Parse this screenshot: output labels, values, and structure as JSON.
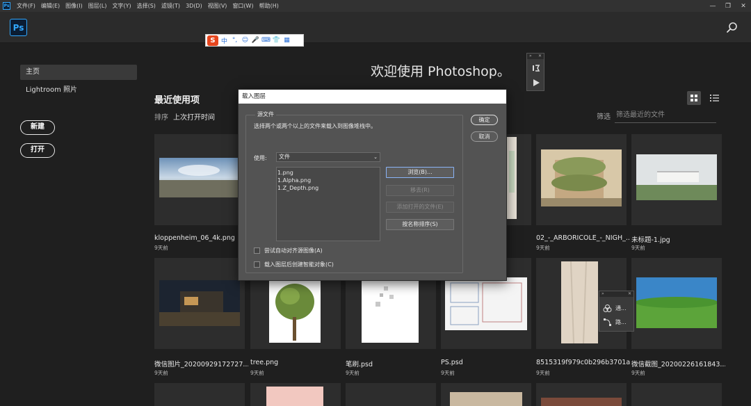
{
  "menubar": {
    "app_icon": "Ps",
    "items": [
      "文件(F)",
      "编辑(E)",
      "图像(I)",
      "图层(L)",
      "文字(Y)",
      "选择(S)",
      "滤镜(T)",
      "3D(D)",
      "视图(V)",
      "窗口(W)",
      "帮助(H)"
    ],
    "window_controls": [
      "—",
      "❐",
      "✕"
    ]
  },
  "header": {
    "logo": "Ps",
    "search_icon": "search-icon"
  },
  "ime": {
    "logo": "S",
    "glyphs": [
      "中",
      "°,",
      "☺",
      "🎤",
      "⌨",
      "👕",
      "▦"
    ]
  },
  "sidebar": {
    "items": [
      "主页",
      "Lightroom 照片"
    ],
    "new_button": "新建",
    "open_button": "打开"
  },
  "home": {
    "welcome": "欢迎使用 Photoshop。",
    "recent_title": "最近使用项",
    "sort_label": "排序",
    "sort_value": "上次打开时间",
    "filter_label": "筛选",
    "filter_placeholder": "筛选最近的文件"
  },
  "files": [
    {
      "name": "kloppenheim_06_4k.png",
      "date": "9天前"
    },
    {
      "name": "",
      "date": ""
    },
    {
      "name": "",
      "date": ""
    },
    {
      "name": "",
      "date": ""
    },
    {
      "name": "02_-_ARBORICOLE_-_NIGH_...",
      "date": "9天前"
    },
    {
      "name": "未标题-1.jpg",
      "date": "9天前"
    },
    {
      "name": "微信图片_20200929172727....",
      "date": "9天前"
    },
    {
      "name": "tree.png",
      "date": "9天前"
    },
    {
      "name": "笔刷.psd",
      "date": "9天前"
    },
    {
      "name": "PS.psd",
      "date": "9天前"
    },
    {
      "name": "8515319f979c0b296b3701a...",
      "date": "9天前"
    },
    {
      "name": "微信截图_20200226161843....",
      "date": "9天前"
    }
  ],
  "float_panel_small": {
    "items": [
      "通...",
      "路..."
    ]
  },
  "dialog": {
    "title": "载入图层",
    "group_label": "源文件",
    "hint": "选择两个或两个以上的文件来载入到图像堆栈中。",
    "use_label": "使用:",
    "use_value": "文件",
    "file_list": [
      "1.png",
      "1.Alpha.png",
      "1.Z_Depth.png"
    ],
    "buttons": {
      "browse": "浏览(B)...",
      "remove": "移去(R)",
      "add_open": "添加打开的文件(E)",
      "sort_by_name": "按名称排序(S)"
    },
    "checkbox_align": "尝试自动对齐源图像(A)",
    "checkbox_smart": "载入图层后创建智能对象(C)",
    "ok": "确定",
    "cancel": "取消"
  },
  "colors": {
    "accent": "#31a8ff",
    "bg": "#1f1f1f",
    "dialog_bg": "#535353"
  }
}
